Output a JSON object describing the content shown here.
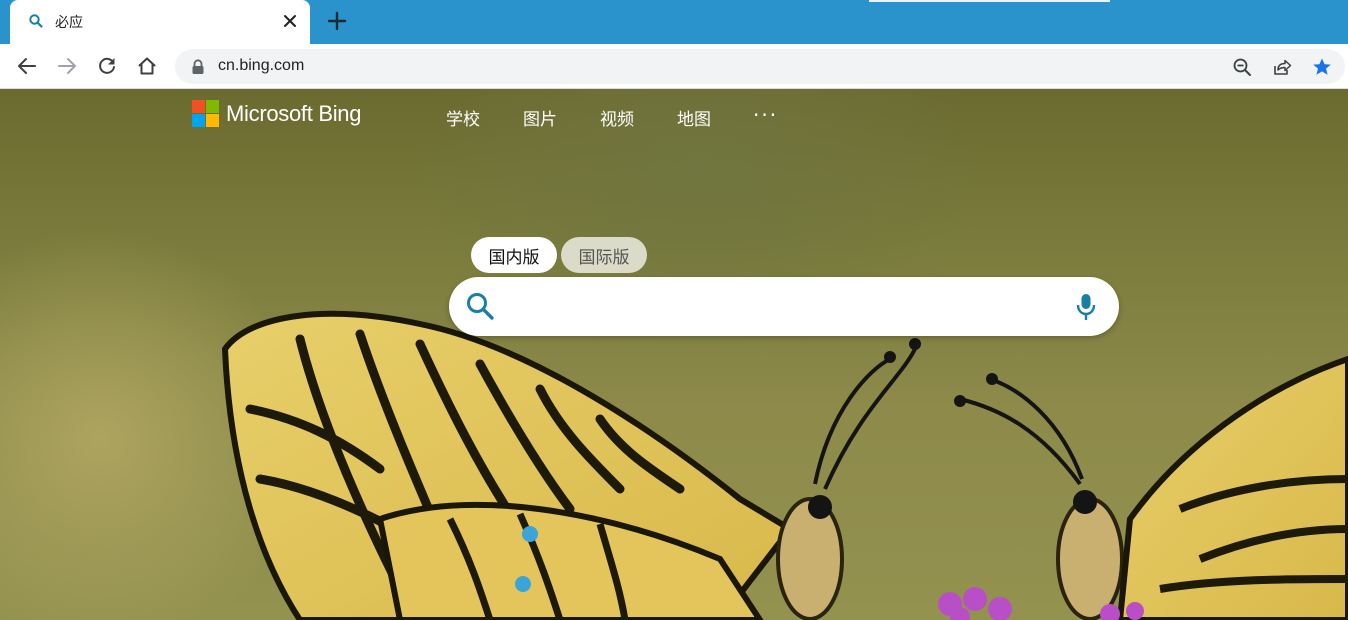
{
  "browser": {
    "tab": {
      "title": "必应",
      "favicon": "search-icon"
    },
    "new_tab_label": "+",
    "url": "cn.bing.com",
    "toolbar_icons": [
      "back-icon",
      "forward-icon",
      "reload-icon",
      "home-icon"
    ],
    "omnibox_icons": [
      "lock-icon",
      "zoom-out-icon",
      "share-icon",
      "bookmark-star-icon"
    ]
  },
  "page": {
    "logo_text": "Microsoft Bing",
    "nav": [
      "学校",
      "图片",
      "视频",
      "地图"
    ],
    "nav_more": "···",
    "search_tabs": {
      "domestic": "国内版",
      "international": "国际版"
    },
    "search": {
      "value": "",
      "placeholder": ""
    },
    "colors": {
      "tab_strip": "#2b93cc",
      "logo_red": "#f25022",
      "logo_green": "#7fba00",
      "logo_blue": "#00a4ef",
      "logo_yellow": "#ffb900",
      "search_icon": "#1a7fa7",
      "star": "#1a73e8"
    }
  }
}
